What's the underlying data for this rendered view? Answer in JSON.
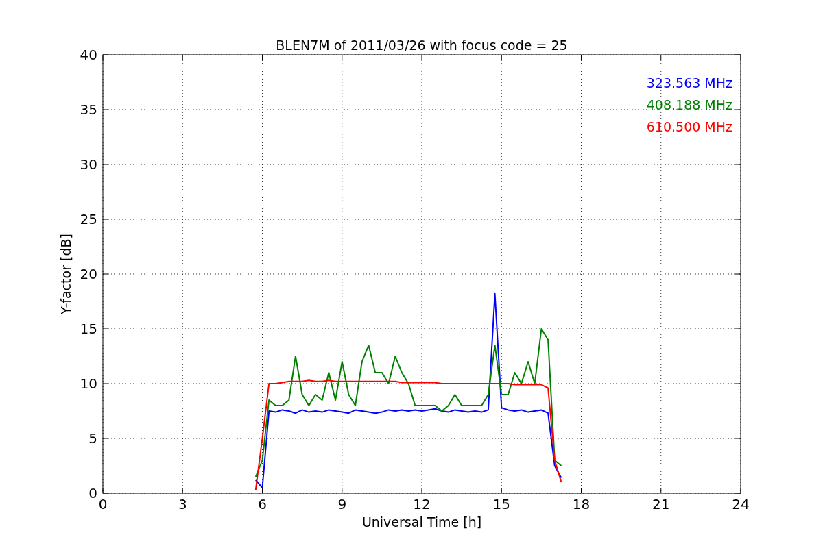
{
  "chart_data": {
    "type": "line",
    "title": "BLEN7M of 2011/03/26 with focus code = 25",
    "xlabel": "Universal Time [h]",
    "ylabel": "Y-factor [dB]",
    "x": [
      5.75,
      6,
      6.25,
      6.5,
      6.75,
      7,
      7.25,
      7.5,
      7.75,
      8,
      8.25,
      8.5,
      8.75,
      9,
      9.25,
      9.5,
      9.75,
      10,
      10.25,
      10.5,
      10.75,
      11,
      11.25,
      11.5,
      11.75,
      12,
      12.25,
      12.5,
      12.75,
      13,
      13.25,
      13.5,
      13.75,
      14,
      14.25,
      14.5,
      14.75,
      15,
      15.25,
      15.5,
      15.75,
      16,
      16.25,
      16.5,
      16.75,
      17,
      17.25
    ],
    "series": [
      {
        "name": "323.563 MHz",
        "color": "#0000ff",
        "values": [
          1.2,
          0.5,
          7.5,
          7.4,
          7.6,
          7.5,
          7.3,
          7.6,
          7.4,
          7.5,
          7.4,
          7.6,
          7.5,
          7.4,
          7.3,
          7.6,
          7.5,
          7.4,
          7.3,
          7.4,
          7.6,
          7.5,
          7.6,
          7.5,
          7.6,
          7.5,
          7.6,
          7.7,
          7.5,
          7.4,
          7.6,
          7.5,
          7.4,
          7.5,
          7.4,
          7.6,
          18.2,
          7.8,
          7.6,
          7.5,
          7.6,
          7.4,
          7.5,
          7.6,
          7.3,
          2.5,
          1.4
        ]
      },
      {
        "name": "408.188 MHz",
        "color": "#008000",
        "values": [
          1.5,
          3,
          8.5,
          8,
          8,
          8.5,
          12.5,
          9,
          8,
          9,
          8.5,
          11,
          8.5,
          12,
          9,
          8,
          12,
          13.5,
          11,
          11,
          10,
          12.5,
          11,
          10,
          8,
          8,
          8,
          8,
          7.5,
          8,
          9,
          8,
          8,
          8,
          8,
          9,
          13.5,
          9,
          9,
          11,
          10,
          12,
          10,
          15,
          14,
          3,
          2.5
        ]
      },
      {
        "name": "610.500 MHz",
        "color": "#ff0000",
        "values": [
          0.3,
          5,
          10,
          10,
          10.1,
          10.2,
          10.2,
          10.2,
          10.3,
          10.2,
          10.2,
          10.3,
          10.2,
          10.2,
          10.2,
          10.2,
          10.2,
          10.2,
          10.2,
          10.2,
          10.2,
          10.2,
          10.1,
          10.1,
          10.1,
          10.1,
          10.1,
          10.1,
          10.0,
          10.0,
          10.0,
          10.0,
          10.0,
          10.0,
          10.0,
          10.0,
          10.0,
          10.0,
          10.0,
          9.9,
          9.9,
          9.9,
          9.9,
          9.9,
          9.6,
          3,
          1
        ]
      }
    ],
    "xlim": [
      0,
      24
    ],
    "ylim": [
      0,
      40
    ],
    "xticks": [
      0,
      3,
      6,
      9,
      12,
      15,
      18,
      21,
      24
    ],
    "yticks": [
      0,
      5,
      10,
      15,
      20,
      25,
      30,
      35,
      40
    ],
    "grid": true
  }
}
